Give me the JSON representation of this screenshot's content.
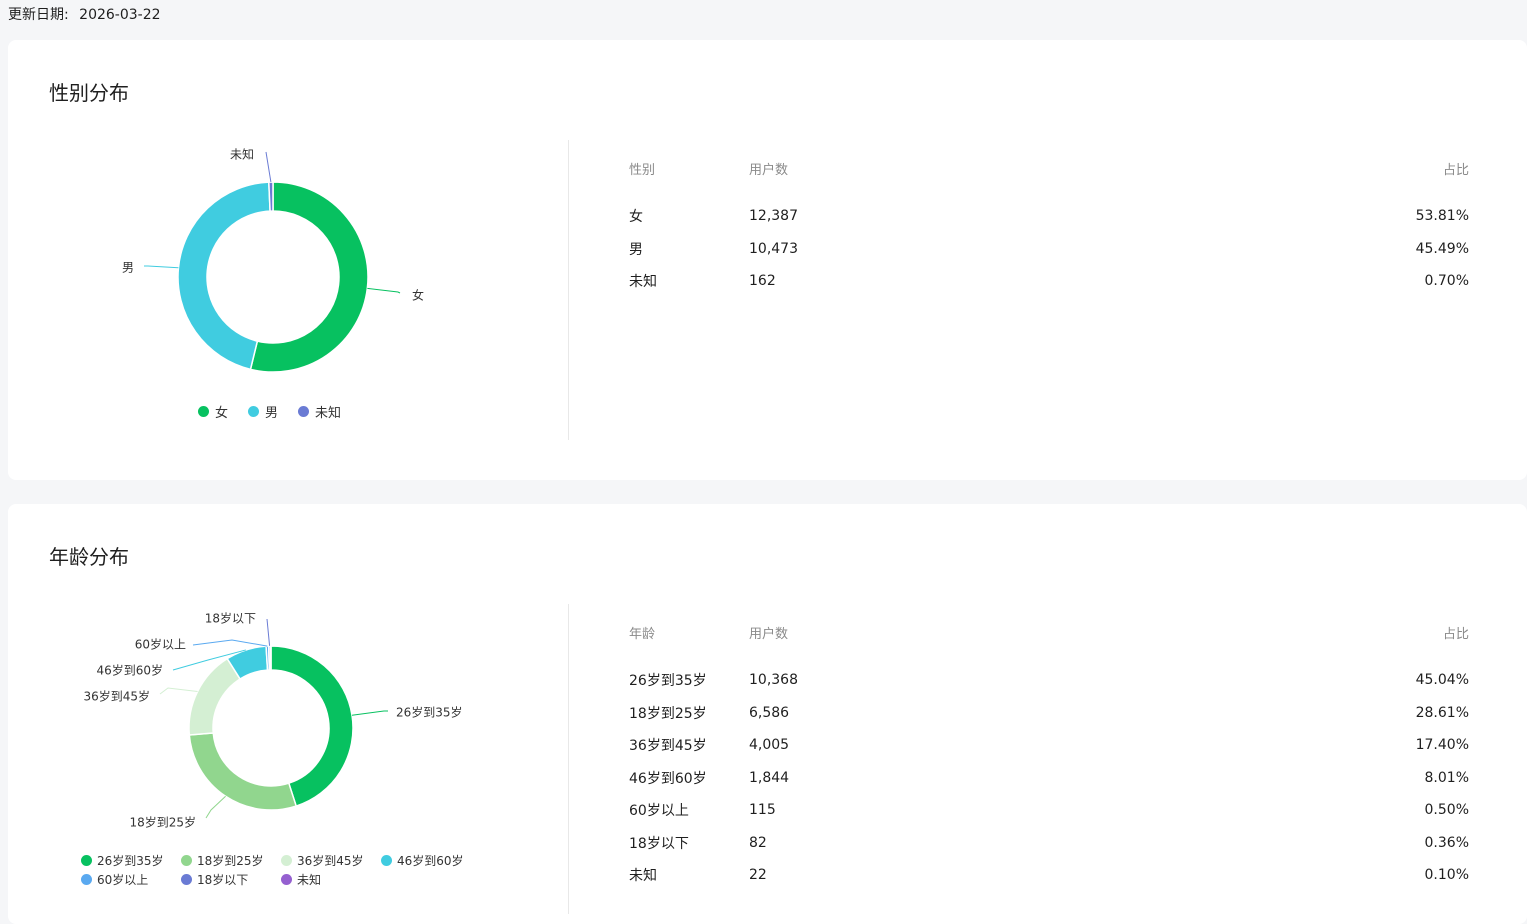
{
  "update": {
    "label": "更新日期:",
    "date": "2026-03-22"
  },
  "gender": {
    "title": "性别分布",
    "headers": {
      "name": "性别",
      "count": "用户数",
      "ratio": "占比"
    },
    "rows": [
      {
        "name": "女",
        "count": "12,387",
        "ratio": "53.81%"
      },
      {
        "name": "男",
        "count": "10,473",
        "ratio": "45.49%"
      },
      {
        "name": "未知",
        "count": "162",
        "ratio": "0.70%"
      }
    ],
    "legend": [
      {
        "label": "女",
        "color": "#07c160"
      },
      {
        "label": "男",
        "color": "#40cce0"
      },
      {
        "label": "未知",
        "color": "#6a7bd4"
      }
    ]
  },
  "age": {
    "title": "年龄分布",
    "headers": {
      "name": "年龄",
      "count": "用户数",
      "ratio": "占比"
    },
    "rows": [
      {
        "name": "26岁到35岁",
        "count": "10,368",
        "ratio": "45.04%"
      },
      {
        "name": "18岁到25岁",
        "count": "6,586",
        "ratio": "28.61%"
      },
      {
        "name": "36岁到45岁",
        "count": "4,005",
        "ratio": "17.40%"
      },
      {
        "name": "46岁到60岁",
        "count": "1,844",
        "ratio": "8.01%"
      },
      {
        "name": "60岁以上",
        "count": "115",
        "ratio": "0.50%"
      },
      {
        "name": "18岁以下",
        "count": "82",
        "ratio": "0.36%"
      },
      {
        "name": "未知",
        "count": "22",
        "ratio": "0.10%"
      }
    ],
    "legend": [
      {
        "label": "26岁到35岁",
        "color": "#07c160"
      },
      {
        "label": "18岁到25岁",
        "color": "#91d68e"
      },
      {
        "label": "36岁到45岁",
        "color": "#d4efd3"
      },
      {
        "label": "46岁到60岁",
        "color": "#40cce0"
      },
      {
        "label": "60岁以上",
        "color": "#5aa9f0"
      },
      {
        "label": "18岁以下",
        "color": "#6a7bd4"
      },
      {
        "label": "未知",
        "color": "#9560d0"
      }
    ]
  },
  "chart_data": [
    {
      "type": "pie",
      "categories": [
        "女",
        "男",
        "未知"
      ],
      "values": [
        12387,
        10473,
        162
      ],
      "colors": [
        "#07c160",
        "#40cce0",
        "#6a7bd4"
      ],
      "legend": "bottom"
    },
    {
      "type": "pie",
      "categories": [
        "26岁到35岁",
        "18岁到25岁",
        "36岁到45岁",
        "46岁到60岁",
        "60岁以上",
        "18岁以下",
        "未知"
      ],
      "values": [
        10368,
        6586,
        4005,
        1844,
        115,
        82,
        22
      ],
      "colors": [
        "#07c160",
        "#91d68e",
        "#d4efd3",
        "#40cce0",
        "#5aa9f0",
        "#6a7bd4",
        "#9560d0"
      ],
      "legend": "bottom"
    }
  ]
}
